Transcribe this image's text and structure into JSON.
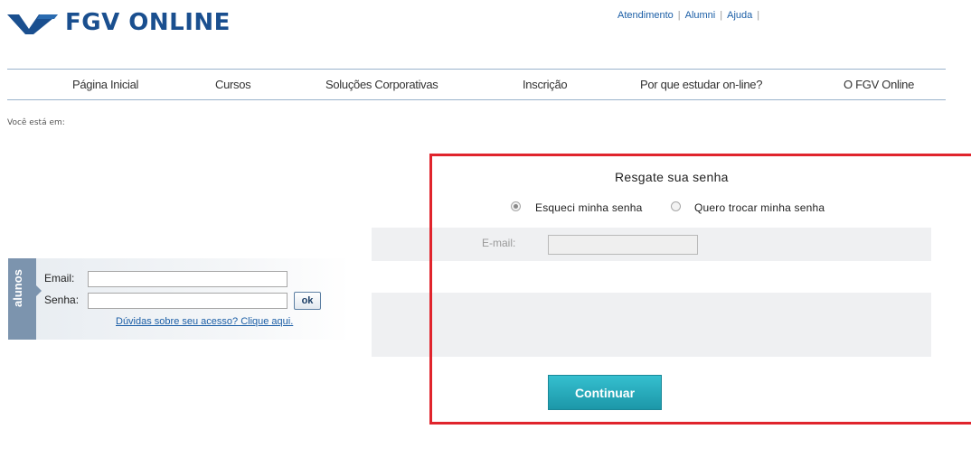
{
  "brand": {
    "logo_text": "FGV ONLINE",
    "logo_color": "#1a4f8f",
    "logo_icon": "fgv-chevron-logo"
  },
  "top_links": {
    "items": [
      {
        "label": "Atendimento"
      },
      {
        "label": "Alumni"
      },
      {
        "label": "Ajuda"
      }
    ],
    "separator": "|"
  },
  "nav": {
    "items": [
      {
        "label": "Página Inicial"
      },
      {
        "label": "Cursos"
      },
      {
        "label": "Soluções Corporativas"
      },
      {
        "label": "Inscrição"
      },
      {
        "label": "Por que estudar on-line?"
      },
      {
        "label": "O FGV Online"
      }
    ]
  },
  "breadcrumb": {
    "label": "Você está em:"
  },
  "student_login": {
    "tab_label": "alunos",
    "email_label": "Email:",
    "email_value": "",
    "password_label": "Senha:",
    "password_value": "",
    "ok_label": "ok",
    "help_link": "Dúvidas sobre seu acesso? Clique aqui."
  },
  "reset": {
    "title": "Resgate sua senha",
    "options": [
      {
        "label": "Esqueci minha senha",
        "selected": true
      },
      {
        "label": "Quero trocar minha senha",
        "selected": false
      }
    ],
    "email_label": "E-mail:",
    "email_value": "",
    "continue_label": "Continuar",
    "highlight_color": "#e0242c",
    "button_color": "#27abbc"
  }
}
